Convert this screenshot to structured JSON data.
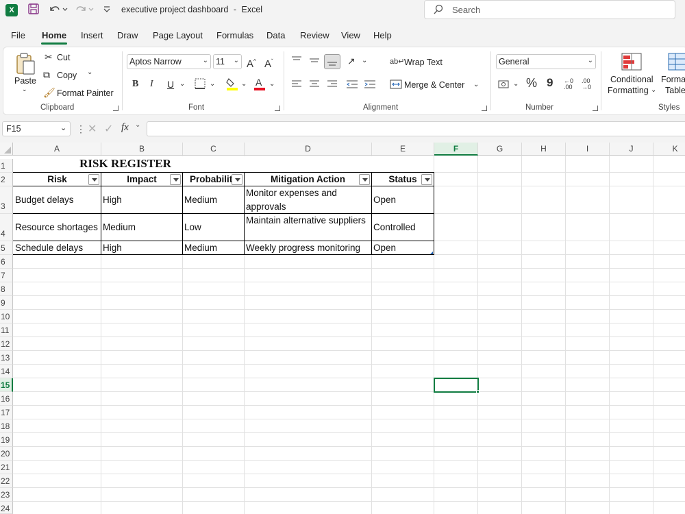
{
  "app": {
    "document_title": "executive project dashboard",
    "separator": "-",
    "app_name": "Excel",
    "search_placeholder": "Search"
  },
  "menu": {
    "tabs": [
      "File",
      "Home",
      "Insert",
      "Draw",
      "Page Layout",
      "Formulas",
      "Data",
      "Review",
      "View",
      "Help"
    ],
    "active": "Home"
  },
  "ribbon": {
    "clipboard": {
      "paste": "Paste",
      "cut": "Cut",
      "copy": "Copy",
      "format_painter": "Format Painter",
      "label": "Clipboard"
    },
    "font": {
      "name": "Aptos Narrow",
      "size": "11",
      "bold": "B",
      "italic": "I",
      "underline": "U",
      "label": "Font"
    },
    "alignment": {
      "wrap_text": "Wrap Text",
      "merge_center": "Merge & Center",
      "label": "Alignment"
    },
    "number": {
      "format": "General",
      "percent": "%",
      "comma": "9",
      "label": "Number"
    },
    "styles": {
      "conditional_1": "Conditional",
      "conditional_2": "Formatting",
      "format_table_1": "Format",
      "format_table_2": "Table",
      "label": "Styles"
    }
  },
  "formula_bar": {
    "name_box": "F15",
    "fx": "fx",
    "formula": ""
  },
  "columns": [
    "A",
    "B",
    "C",
    "D",
    "E",
    "F",
    "G",
    "H",
    "I",
    "J",
    "K"
  ],
  "selected_column": "F",
  "rows": [
    "1",
    "2",
    "3",
    "4",
    "5",
    "6",
    "7",
    "8",
    "9",
    "10",
    "11",
    "12",
    "13",
    "14",
    "15",
    "16",
    "17",
    "18",
    "19",
    "20",
    "21",
    "22",
    "23",
    "24"
  ],
  "selected_row": "15",
  "sheet": {
    "title": "RISK REGISTER",
    "headers": [
      "Risk",
      "Impact",
      "Probability",
      "Mitigation Action",
      "Status"
    ],
    "rows": [
      [
        "Budget delays",
        "High",
        "Medium",
        "Monitor expenses and approvals",
        "Open"
      ],
      [
        "Resource shortages",
        "Medium",
        "Low",
        "Maintain alternative suppliers",
        "Controlled"
      ],
      [
        "Schedule delays",
        "High",
        "Medium",
        "Weekly progress monitoring",
        "Open"
      ]
    ]
  },
  "colors": {
    "accent": "#107c41",
    "font_color_bar": "#e81123",
    "highlight_bar": "#ffff00"
  }
}
